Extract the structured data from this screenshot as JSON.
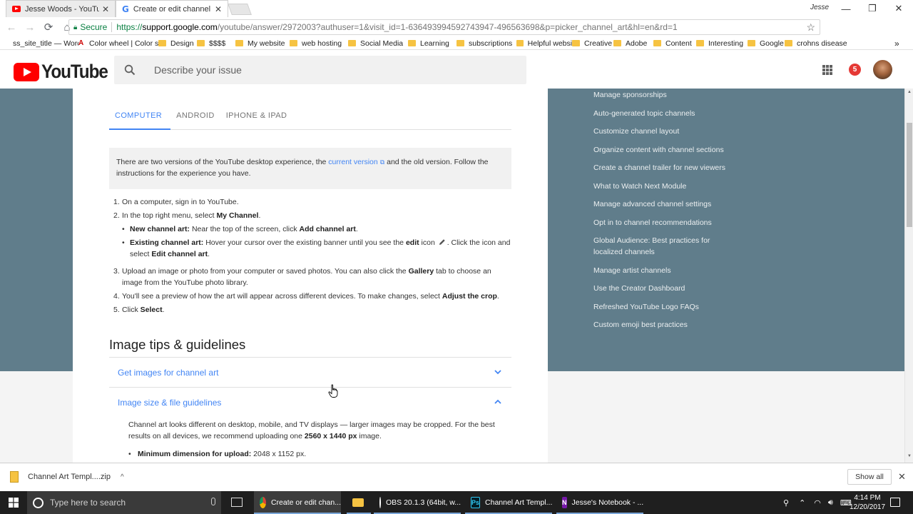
{
  "browser": {
    "tabs": [
      {
        "title": "Jesse Woods - YouTube",
        "close": "✕"
      },
      {
        "title": "Create or edit channel ar",
        "close": "✕"
      }
    ],
    "profile_name": "Jesse",
    "window_controls": {
      "minimize": "—",
      "restore": "❐",
      "close": "✕"
    },
    "nav": {
      "back": "←",
      "forward": "→",
      "reload": "⟳",
      "home": "⌂"
    },
    "omnibox": {
      "secure_label": "Secure",
      "scheme": "https://",
      "host": "support.google.com",
      "path": "/youtube/answer/2972003?authuser=1&visit_id=1-636493994592743947-496563698&p=picker_channel_art&hl=en&rd=1"
    },
    "bookmarks": [
      {
        "label": "ss_site_title — Word",
        "icon": "site"
      },
      {
        "label": "Color wheel | Color s",
        "icon": "adobe"
      },
      {
        "label": "Design",
        "icon": "folder"
      },
      {
        "label": "$$$$",
        "icon": "folder"
      },
      {
        "label": "My website",
        "icon": "folder"
      },
      {
        "label": "web hosting",
        "icon": "folder"
      },
      {
        "label": "Social Media",
        "icon": "folder"
      },
      {
        "label": "Learning",
        "icon": "folder"
      },
      {
        "label": "subscriptions",
        "icon": "folder"
      },
      {
        "label": "Helpful website",
        "icon": "folder"
      },
      {
        "label": "Creative",
        "icon": "folder"
      },
      {
        "label": "Adobe",
        "icon": "folder"
      },
      {
        "label": "Content",
        "icon": "folder"
      },
      {
        "label": "Interesting",
        "icon": "folder"
      },
      {
        "label": "Google",
        "icon": "folder"
      },
      {
        "label": "crohns disease",
        "icon": "folder"
      }
    ],
    "bookmarks_more": "»"
  },
  "header": {
    "logo_text": "YouTube",
    "search_placeholder": "Describe your issue",
    "notification_count": "5"
  },
  "article": {
    "platform_tabs": [
      "COMPUTER",
      "ANDROID",
      "IPHONE & IPAD"
    ],
    "notice": {
      "before_link": "There are two versions of the YouTube desktop experience, the ",
      "link": "current version",
      "after_link": " and the old version. Follow the instructions for the experience you have."
    },
    "steps": {
      "s1": "On a computer, sign in to YouTube.",
      "s2_text": "In the top right menu, select ",
      "s2_bold": "My Channel",
      "b1_bold": "New channel art:",
      "b1_text": " Near the top of the screen, click ",
      "b1_bold2": "Add channel art",
      "b2_bold": "Existing channel art:",
      "b2_text1": " Hover your cursor over the existing banner until you see the ",
      "b2_bold2": "edit",
      "b2_text2": " icon ",
      "b2_text3": ". Click the icon and select ",
      "b2_bold3": "Edit channel art",
      "s3_text1": "Upload an image or photo from your computer or saved photos. You can also click the ",
      "s3_bold": "Gallery",
      "s3_text2": " tab to choose an image from the YouTube photo library.",
      "s4_text": "You'll see a preview of how the art will appear across different devices. To make changes, select ",
      "s4_bold": "Adjust the crop",
      "s5_text": "Click ",
      "s5_bold": "Select"
    },
    "tips_heading": "Image tips & guidelines",
    "accordions": [
      {
        "title": "Get images for channel art",
        "expanded": false
      },
      {
        "title": "Image size & file guidelines",
        "expanded": true
      }
    ],
    "size_body": {
      "text1": "Channel art looks different on desktop, mobile, and TV displays — larger images may be cropped. For the best results on all devices, we recommend uploading one ",
      "bold": "2560 x 1440 px",
      "text2": " image.",
      "min_label": "Minimum dimension for upload:",
      "min_value": " 2048 x 1152 px."
    }
  },
  "side_nav": [
    "Manage sponsorships",
    "Auto-generated topic channels",
    "Customize channel layout",
    "Organize content with channel sections",
    "Create a channel trailer for new viewers",
    "What to Watch Next Module",
    "Manage advanced channel settings",
    "Opt in to channel recommendations",
    "Global Audience: Best practices for",
    "localized channels",
    "Manage artist channels",
    "Use the Creator Dashboard",
    "Refreshed YouTube Logo FAQs",
    "Custom emoji best practices"
  ],
  "download_bar": {
    "file": "Channel Art Templ....zip",
    "caret": "^",
    "show_all": "Show all",
    "close": "✕"
  },
  "taskbar": {
    "search_placeholder": "Type here to search",
    "apps": [
      "Create or edit chan...",
      "",
      "OBS 20.1.3 (64bit, w...",
      "Channel Art Templ...",
      "Jesse's Notebook - ..."
    ],
    "clock_time": "4:14 PM",
    "clock_date": "12/20/2017"
  },
  "colors": {
    "accent_blue": "#4285f4",
    "youtube_red": "#ff0000",
    "band": "#607d8b"
  }
}
